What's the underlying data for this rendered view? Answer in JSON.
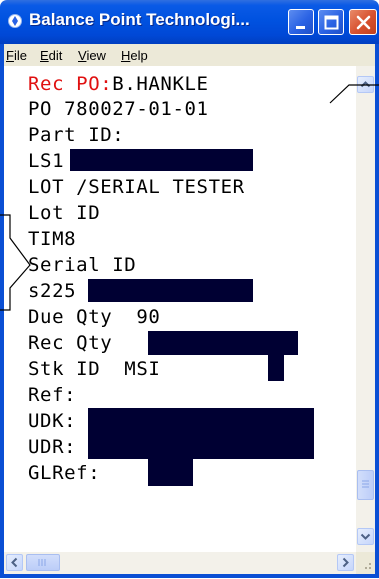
{
  "window": {
    "title": "Balance Point Technologi...",
    "buttons": {
      "minimize": "minimize",
      "maximize": "maximize",
      "close": "close"
    }
  },
  "menu": [
    "File",
    "Edit",
    "View",
    "Help"
  ],
  "screen": {
    "rec_po_label": "Rec PO:",
    "rec_po_user": "B.HANKLE",
    "po": "PO 780027-01-01",
    "part_id_label": "Part ID:",
    "part_id_value": "LS1",
    "part_desc": "LOT /SERIAL TESTER",
    "lot_id_label": "Lot ID",
    "lot_id_value": "TIM8",
    "serial_id_label": "Serial ID",
    "serial_id_value": "s225",
    "due_qty": "Due Qty  90",
    "rec_qty_label": "Rec Qty",
    "stk_id": "Stk ID  MSI",
    "ref_label": "Ref:",
    "udk_label": "UDK:",
    "udr_label": "UDR:",
    "glref_label": "GLRef:"
  },
  "colors": {
    "title_bar": "#0052e0",
    "highlight_label": "#e01010",
    "redaction": "#000033"
  }
}
